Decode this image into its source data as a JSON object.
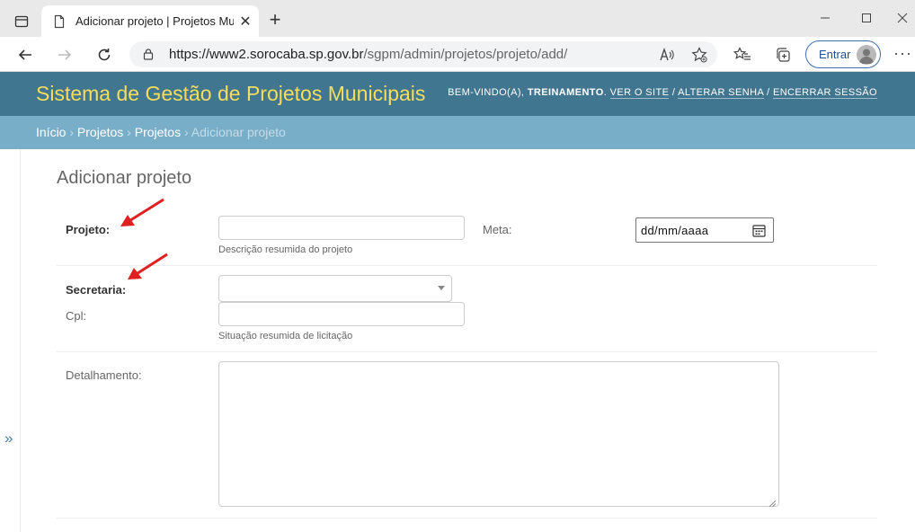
{
  "browser": {
    "tab_title": "Adicionar projeto | Projetos Municipais",
    "new_tab": "+",
    "close_tab": "✕",
    "url_host": "https://www2.sorocaba.sp.gov.br",
    "url_path": "/sgpm/admin/projetos/projeto/add/",
    "read_aloud": "A)",
    "signin_label": "Entrar",
    "more": "···",
    "icons": [
      "tab-actions-icon",
      "page-icon",
      "back-arrow-icon",
      "forward-arrow-icon",
      "refresh-icon",
      "lock-icon",
      "read-aloud-icon",
      "add-favorite-icon",
      "favorites-icon",
      "collections-icon",
      "profile-avatar-icon",
      "minimize-icon",
      "maximize-icon",
      "close-window-icon"
    ]
  },
  "header": {
    "site_name": "Sistema de Gestão de Projetos Municipais",
    "welcome": "BEM-VINDO(A), ",
    "username": "TREINAMENTO",
    "sep1": ". ",
    "view_site": "VER O SITE",
    "sep2": " / ",
    "change_password": "ALTERAR SENHA",
    "sep3": " / ",
    "logout": "ENCERRAR SESSÃO",
    "colors": {
      "header_bg": "#417690",
      "branding": "#f5dd5d",
      "breadcrumbs_bg": "#79aec8"
    }
  },
  "breadcrumbs": {
    "home": "Início",
    "app": "Projetos",
    "model": "Projetos",
    "current": "Adicionar projeto",
    "separator": " › "
  },
  "sidebar": {
    "toggle": "»"
  },
  "form": {
    "title": "Adicionar projeto",
    "projeto": {
      "label": "Projeto:",
      "value": "",
      "help": "Descrição resumida do projeto"
    },
    "meta": {
      "label": "Meta:",
      "placeholder": "dd/mm/aaaa"
    },
    "secretaria": {
      "label": "Secretaria:",
      "selected": ""
    },
    "cpl": {
      "label": "Cpl:",
      "value": "",
      "help": "Situação resumida de licitação"
    },
    "detalhamento": {
      "label": "Detalhamento:",
      "value": ""
    }
  },
  "annotations": {
    "arrow_color": "#e02020"
  }
}
